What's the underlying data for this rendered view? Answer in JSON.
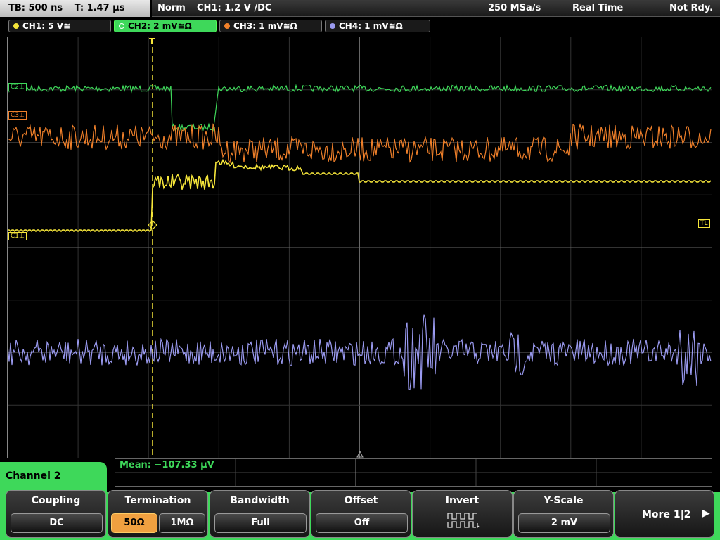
{
  "top": {
    "timebase": "TB: 500 ns",
    "trigger_time": "T: 1.47 µs",
    "mode": "Norm",
    "trigger": "CH1: 1.2 V ∕DC",
    "sample_rate": "250 MSa/s",
    "acquisition": "Real Time",
    "ready": "Not Rdy."
  },
  "channels": [
    {
      "label": "CH1: 5 V≅",
      "color": "#f5e53a"
    },
    {
      "label": "CH2: 2 mV≅Ω",
      "color": "#3ed85a"
    },
    {
      "label": "CH3: 1 mV≅Ω",
      "color": "#f0802a"
    },
    {
      "label": "CH4: 1 mV≅Ω",
      "color": "#9a9af0"
    }
  ],
  "markers": {
    "c2": "C2⊥",
    "c3": "C3⊥",
    "c1": "C1⊥",
    "tl": "TL",
    "trig": "T"
  },
  "measurement": "Mean: −107.33 µV",
  "menu": {
    "title": "Channel 2",
    "coupling": {
      "title": "Coupling",
      "value": "DC"
    },
    "termination": {
      "title": "Termination",
      "options": [
        "50Ω",
        "1MΩ"
      ],
      "selected": "50Ω"
    },
    "bandwidth": {
      "title": "Bandwidth",
      "value": "Full"
    },
    "offset": {
      "title": "Offset",
      "value": "Off"
    },
    "invert": {
      "title": "Invert"
    },
    "yscale": {
      "title": "Y-Scale",
      "value": "2 mV"
    },
    "more": "More 1|2"
  }
}
